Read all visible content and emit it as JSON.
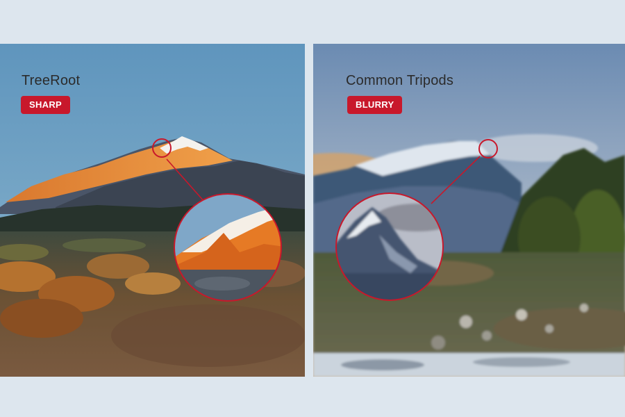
{
  "panels": [
    {
      "brand": "TreeRoot",
      "badge": "SHARP",
      "badge_color": "#c8182b"
    },
    {
      "brand": "Common Tripods",
      "badge": "BLURRY",
      "badge_color": "#c8182b"
    }
  ],
  "colors": {
    "page_background": "#dde6ee",
    "accent_red": "#c8182b"
  }
}
